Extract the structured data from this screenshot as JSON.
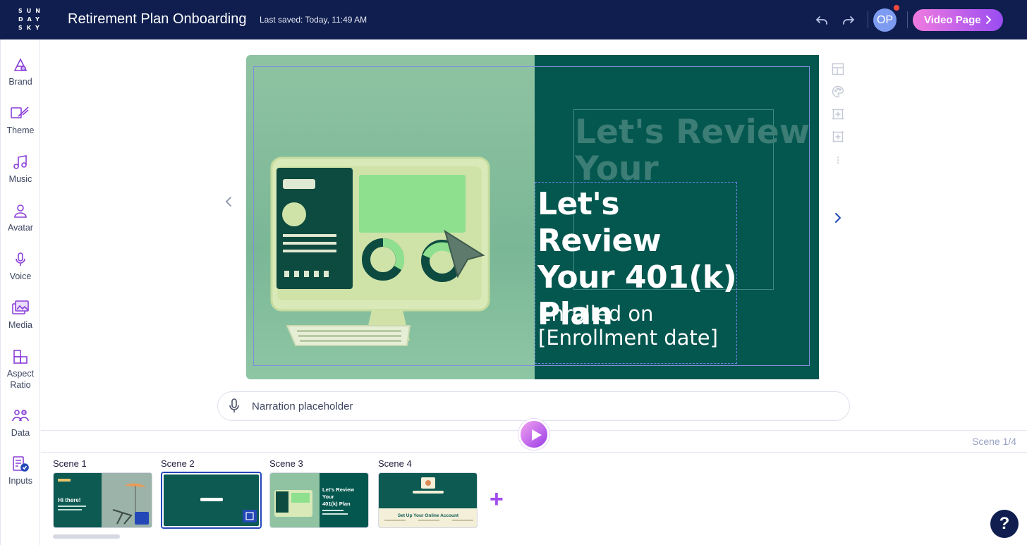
{
  "header": {
    "logo_lines": [
      "SUN",
      "DAY",
      "SKY"
    ],
    "project_title": "Retirement Plan Onboarding",
    "last_saved": "Last saved: Today, 11:49 AM",
    "avatar_initials": "OP",
    "video_page_label": "Video Page"
  },
  "sidebar": {
    "items": [
      {
        "label": "Brand",
        "icon": "brand-icon"
      },
      {
        "label": "Theme",
        "icon": "theme-icon"
      },
      {
        "label": "Music",
        "icon": "music-icon"
      },
      {
        "label": "Avatar",
        "icon": "avatar-icon"
      },
      {
        "label": "Voice",
        "icon": "voice-icon"
      },
      {
        "label": "Media",
        "icon": "media-icon"
      },
      {
        "label": "Aspect\nRatio",
        "icon": "aspect-ratio-icon"
      },
      {
        "label": "Data",
        "icon": "data-icon"
      },
      {
        "label": "Inputs",
        "icon": "inputs-icon"
      }
    ]
  },
  "canvas": {
    "ghost_title": "Let's Review Your",
    "ghost_suffix": "n",
    "title": "Let's Review Your 401(k) Plan",
    "subtitle": "Enrolled on [Enrollment date]"
  },
  "narration": {
    "placeholder": "Narration placeholder"
  },
  "timeline": {
    "scene_counter": "Scene 1/4",
    "scenes": [
      {
        "label": "Scene 1",
        "thumb_text": "Hi there!"
      },
      {
        "label": "Scene 2",
        "thumb_text": ""
      },
      {
        "label": "Scene 3",
        "thumb_text": "Let's Review Your 401(k) Plan"
      },
      {
        "label": "Scene 4",
        "thumb_text": "Set Up Your Online Account"
      }
    ]
  },
  "help_label": "?",
  "colors": {
    "topbar": "#0f1e4f",
    "accent_purple": "#9a4cf1",
    "canvas_dark_green": "#04574f",
    "canvas_light_green": "#8fc3a2",
    "selection_blue": "#2447b8"
  }
}
